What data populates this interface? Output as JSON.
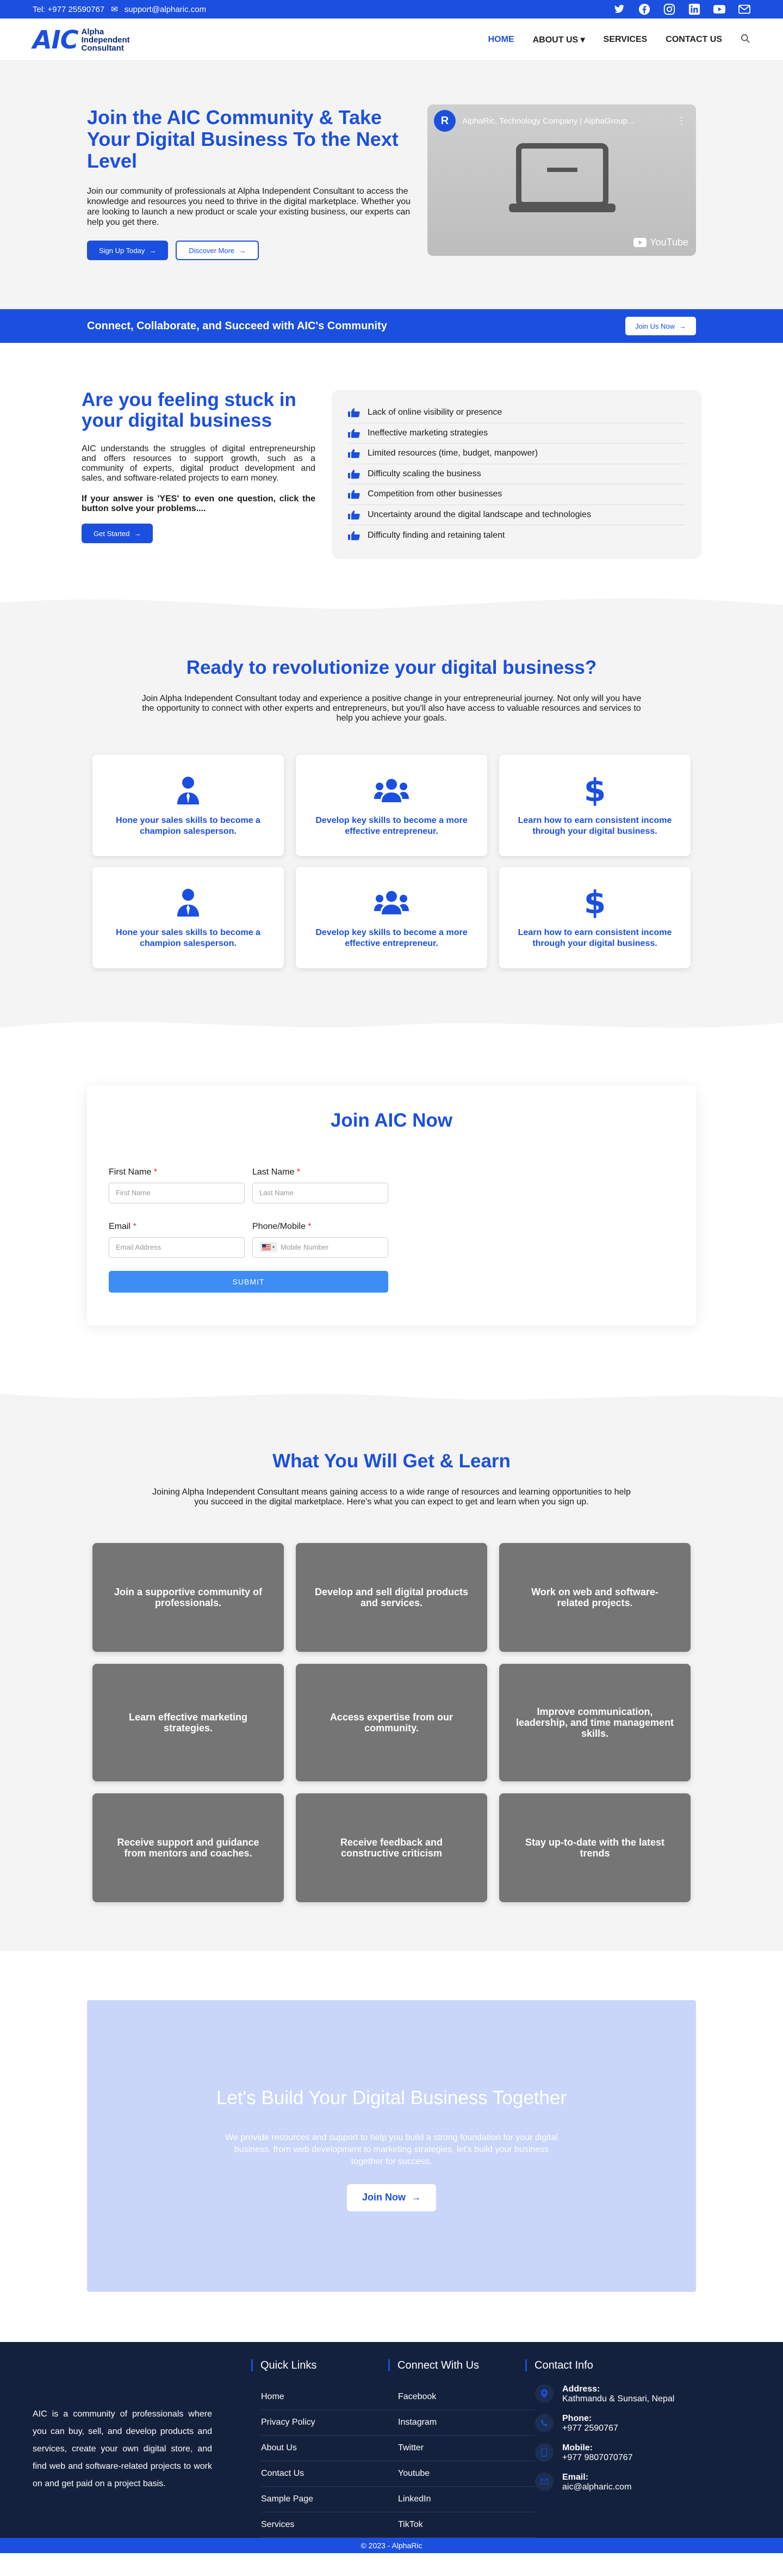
{
  "topbar": {
    "phone": "Tel: +977 25590767",
    "email": "support@alpharic.com",
    "social": [
      "twitter-icon",
      "facebook-icon",
      "instagram-icon",
      "linkedin-icon",
      "youtube-icon",
      "mail-icon"
    ]
  },
  "header": {
    "logo_mark": "AIC",
    "logo_line1": "Alpha",
    "logo_line2": "Independent",
    "logo_line3": "Consultant",
    "nav": [
      "HOME",
      "ABOUT US",
      "SERVICES",
      "CONTACT US"
    ]
  },
  "hero": {
    "title": "Join the AIC Community & Take Your Digital Business To the Next Level",
    "text": "Join our community of professionals at Alpha Independent Consultant to access the knowledge and resources you need to thrive in the digital marketplace. Whether you are looking to launch a new product or scale your existing business, our experts can help you get there.",
    "btn_primary": "Sign Up Today",
    "btn_secondary": "Discover More",
    "video_title": "AlphaRic, Technology Company | AlphaGroup...",
    "video_channel": "R",
    "video_brand": "YouTube"
  },
  "banner": {
    "text": "Connect, Collaborate, and Succeed with AIC's Community",
    "button": "Join Us Now"
  },
  "stuck": {
    "title": "Are you feeling stuck in your digital business",
    "text": "AIC understands the struggles of digital entrepreneurship and offers resources to support growth, such as a community of experts, digital product development and sales, and software-related projects to earn money.",
    "question": "If your answer is 'YES' to even one question, click the button solve your problems....",
    "button": "Get Started",
    "items": [
      "Lack of online visibility or presence",
      "Ineffective marketing strategies",
      "Limited resources (time, budget, manpower)",
      "Difficulty scaling the business",
      "Competition from other businesses",
      "Uncertainty around the digital landscape and technologies",
      "Difficulty finding and retaining talent"
    ]
  },
  "revolution": {
    "title": "Ready to revolutionize your digital business?",
    "text": "Join Alpha Independent Consultant today and experience a positive change in your entrepreneurial journey. Not only will you have the opportunity to connect with other experts and entrepreneurs, but you'll also have access to valuable resources and services to help you achieve your goals.",
    "cards": [
      {
        "icon": "person-icon",
        "text": "Hone your sales skills to become a champion salesperson."
      },
      {
        "icon": "users-icon",
        "text": "Develop key skills to become a more effective entrepreneur."
      },
      {
        "icon": "dollar-icon",
        "text": "Learn how to earn consistent income through your digital business."
      },
      {
        "icon": "person-icon",
        "text": "Hone your sales skills to become a champion salesperson."
      },
      {
        "icon": "users-icon",
        "text": "Develop key skills to become a more effective entrepreneur."
      },
      {
        "icon": "dollar-icon",
        "text": "Learn how to earn consistent income through your digital business."
      }
    ]
  },
  "form": {
    "title": "Join AIC Now",
    "first_name_label": "First Name",
    "first_name_placeholder": "First Name",
    "last_name_label": "Last Name",
    "last_name_placeholder": "Last Name",
    "email_label": "Email",
    "email_placeholder": "Email Address",
    "phone_label": "Phone/Mobile",
    "phone_placeholder": "Mobile Number",
    "required_mark": "*",
    "submit": "SUBMIT"
  },
  "learn": {
    "title": "What You Will Get & Learn",
    "text": "Joining Alpha Independent Consultant means gaining access to a wide range of resources and learning opportunities to help you succeed in the digital marketplace. Here's what you can expect to get and learn when you sign up.",
    "cards": [
      "Join a supportive community of professionals.",
      "Develop and sell digital products and services.",
      "Work on web and software-related projects.",
      "Learn effective marketing strategies.",
      "Access expertise from our community.",
      "Improve communication, leadership, and time management skills.",
      "Receive support and guidance from mentors and coaches.",
      "Receive feedback and constructive criticism",
      "Stay up-to-date with the latest trends"
    ]
  },
  "cta": {
    "title": "Let's Build Your Digital Business Together",
    "text": "We provide resources and support to help you build a strong foundation for your digital business. from web development to marketing strategies, let's build your business together for success.",
    "button": "Join Now"
  },
  "footer": {
    "about": "AIC is a community of professionals where you can buy, sell, and develop products and services, create your own digital store, and find web and software-related projects to work on and get paid on a project basis.",
    "quick_title": "Quick Links",
    "quick_links": [
      "Home",
      "Privacy Policy",
      "About Us",
      "Contact Us",
      "Sample Page",
      "Services"
    ],
    "connect_title": "Connect With Us",
    "connect_links": [
      "Facebook",
      "Instagram",
      "Twitter",
      "Youtube",
      "LinkedIn",
      "TikTok"
    ],
    "contact_title": "Contact Info",
    "address_label": "Address:",
    "address": "Kathmandu & Sunsari, Nepal",
    "phone_label": "Phone:",
    "phone": "+977 2590767",
    "mobile_label": "Mobile:",
    "mobile": "+977 9807070767",
    "email_label": "Email:",
    "email": "aic@alpharic.com",
    "copyright": "© 2023 - AlphaRic"
  },
  "colors": {
    "brand": "#1b4fe0",
    "footer": "#14213d",
    "card_grey": "#757575",
    "cta_bg": "#c9d6fa"
  }
}
